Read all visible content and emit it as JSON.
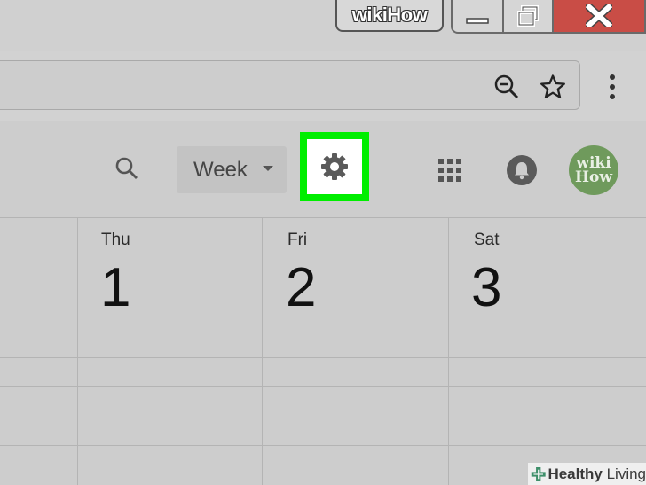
{
  "window": {
    "brand": "wikiHow",
    "buttons": [
      "minimize",
      "maximize",
      "close"
    ]
  },
  "browser": {
    "icons": [
      "zoom-out-icon",
      "star-icon",
      "more-vert-icon"
    ]
  },
  "calendar_header": {
    "view_select": "Week",
    "icons": [
      "search-icon",
      "gear-icon",
      "apps-grid-icon",
      "bell-icon"
    ],
    "highlight_color": "#00ee00",
    "avatar_text_line1": "wiki",
    "avatar_text_line2": "How"
  },
  "days": [
    {
      "name": "Thu",
      "number": "1"
    },
    {
      "name": "Fri",
      "number": "2"
    },
    {
      "name": "Sat",
      "number": "3"
    }
  ],
  "watermark": {
    "bold": "Healthy",
    "rest": " Living"
  }
}
